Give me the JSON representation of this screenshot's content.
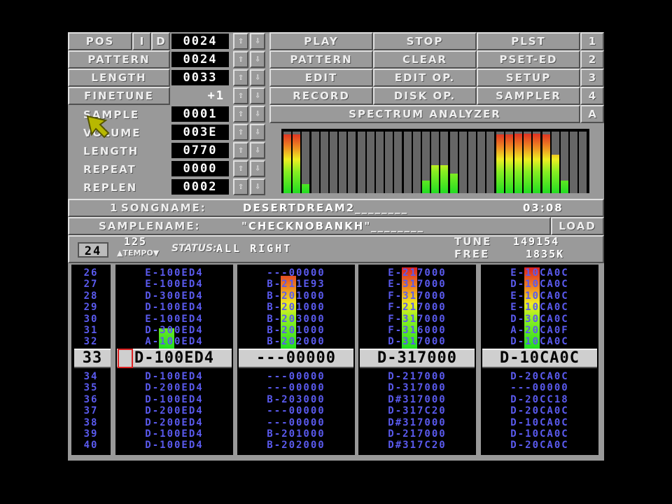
{
  "left_panel": {
    "pos": {
      "label": "POS",
      "i": "I",
      "d": "D",
      "value": "0024"
    },
    "pattern": {
      "label": "PATTERN",
      "value": "0024"
    },
    "length": {
      "label": "LENGTH",
      "value": "0033"
    },
    "finetune": {
      "label": "FINETUNE",
      "value": "+1"
    },
    "sample": {
      "label": "SAMPLE",
      "value": "0001"
    },
    "volume": {
      "label": "VOLUME",
      "value": "003E"
    },
    "sample_length": {
      "label": "LENGTH",
      "value": "0770"
    },
    "repeat": {
      "label": "REPEAT",
      "value": "0000"
    },
    "replen": {
      "label": "REPLEN",
      "value": "0002"
    },
    "arrow_up": "⇧",
    "arrow_down": "⇩"
  },
  "buttons": {
    "play": "PLAY",
    "stop": "STOP",
    "plst": "PLST",
    "n1": "1",
    "pattern": "PATTERN",
    "clear": "CLEAR",
    "pset_ed": "PSET-ED",
    "n2": "2",
    "edit": "EDIT",
    "edit_op": "EDIT OP.",
    "setup": "SETUP",
    "n3": "3",
    "record": "RECORD",
    "disk_op": "DISK OP.",
    "sampler": "SAMPLER",
    "n4": "4",
    "spectrum": "SPECTRUM ANALYZER",
    "a": "A"
  },
  "spectrum_levels": [
    0.95,
    0.95,
    0.15,
    0,
    0,
    0,
    0,
    0,
    0,
    0,
    0,
    0,
    0,
    0,
    0,
    0.2,
    0.45,
    0.45,
    0.32,
    0,
    0,
    0,
    0,
    0.95,
    0.95,
    0.97,
    0.97,
    0.97,
    0.95,
    0.62,
    0.2,
    0,
    0
  ],
  "song": {
    "prefix": "1",
    "label": "SONGNAME:",
    "value": "DESERTDREAM2________",
    "time": "03:08"
  },
  "samplename": {
    "label": "SAMPLENAME:",
    "value": "\"CHECKNOBANKH\"________",
    "load": "LOAD"
  },
  "status": {
    "speed": "24",
    "tempo_value": "125",
    "tempo_label": "▲TEMPO▼",
    "status_label": "STATUS:",
    "status_value": "ALL RIGHT",
    "tune_label": "TUNE",
    "tune_value": "149154",
    "free_label": "FREE",
    "free_value": "1835K"
  },
  "rows_above": [
    "26",
    "27",
    "28",
    "29",
    "30",
    "31",
    "32"
  ],
  "current_row": "33",
  "rows_below": [
    "34",
    "35",
    "36",
    "37",
    "38",
    "39",
    "40"
  ],
  "tracks": [
    {
      "above": [
        "E-100ED4",
        "E-100ED4",
        "D-300ED4",
        "D-100ED4",
        "E-100ED4",
        "D-300ED4",
        "A-100ED4"
      ],
      "current": "D-100ED4",
      "below": [
        "D-100ED4",
        "D-200ED4",
        "D-100ED4",
        "D-200ED4",
        "D-200ED4",
        "D-100ED4",
        "D-100ED4"
      ],
      "vu": 0.25
    },
    {
      "above": [
        "---00000",
        "B-211E93",
        "B-201000",
        "B-201000",
        "B-203000",
        "B-201000",
        "B-202000"
      ],
      "current": "---00000",
      "below": [
        "---00000",
        "---00000",
        "B-203000",
        "---00000",
        "---00000",
        "B-201000",
        "B-202000"
      ],
      "vu": 0.9
    },
    {
      "above": [
        "E-217000",
        "E-317000",
        "F-317000",
        "F-217000",
        "F-317000",
        "F-316000",
        "D-317000"
      ],
      "current": "D-317000",
      "below": [
        "D-217000",
        "D-317000",
        "D#317000",
        "D-317C20",
        "D#317000",
        "D-217000",
        "D#317C20"
      ],
      "vu": 1.0
    },
    {
      "above": [
        "E-10CA0C",
        "D-10CA0C",
        "E-10CA0C",
        "E-10CA0C",
        "D-30CA0C",
        "A-20CA0F",
        "D-10CA0C"
      ],
      "current": "D-10CA0C",
      "below": [
        "D-20CA0C",
        "---00000",
        "D-20CC18",
        "D-20CA0C",
        "D-10CA0C",
        "D-10CA0C",
        "D-20CA0C"
      ],
      "vu": 1.0
    }
  ]
}
